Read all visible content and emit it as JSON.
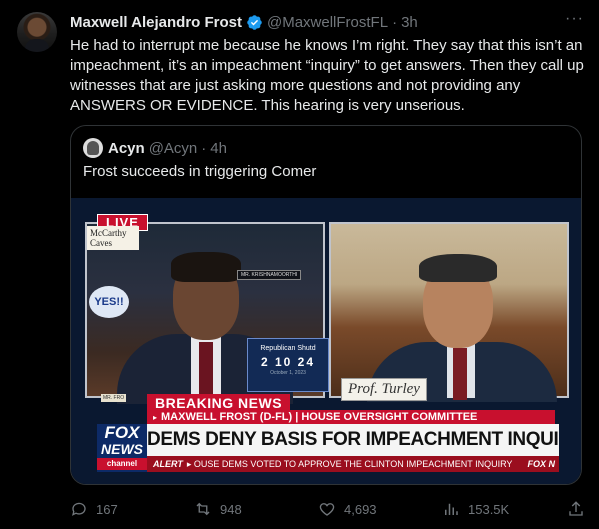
{
  "tweet": {
    "author_name": "Maxwell Alejandro Frost",
    "handle": "@MaxwellFrostFL",
    "separator": "·",
    "time": "3h",
    "more": "···",
    "text": "He had to interrupt me because he knows I’m right. They say that this isn’t an impeachment, it’s an impeachment “inquiry” to get answers. Then they call up witnesses that are just asking more questions and not providing any ANSWERS OR EVIDENCE. This hearing is very unserious."
  },
  "quote": {
    "author_name": "Acyn",
    "handle": "@Acyn",
    "separator": "·",
    "time": "4h",
    "text": "Frost succeeds in triggering Comer",
    "video": {
      "live_label": "LIVE",
      "sign_text": "McCarthy Caves",
      "yes_text": "YES!!",
      "left_namecard": "MR. KRISHNAMOORTHI",
      "countdown_title": "Republican Shutd",
      "countdown_nums": "2  10  24",
      "countdown_date": "October 1, 2023",
      "right_namecard": "Prof. Turley",
      "left_bottom_card": "MR. FRO",
      "breaking_label": "BREAKING NEWS",
      "subline": "MAXWELL FROST (D-FL) | HOUSE OVERSIGHT COMMITTEE",
      "headline": "DEMS DENY BASIS FOR IMPEACHMENT INQUIRY HEARING",
      "alert_label": "ALERT",
      "alert_text": "OUSE DEMS VOTED TO APPROVE THE CLINTON IMPEACHMENT INQUIRY",
      "alert_logo": "FOX N",
      "logo_line1": "FOX",
      "logo_line2": "NEWS",
      "logo_line3": "channel"
    }
  },
  "actions": {
    "replies": "167",
    "reposts": "948",
    "likes": "4,693",
    "views": "153.5K"
  },
  "colors": {
    "background": "#000000",
    "text": "#e7e9ea",
    "muted": "#71767b",
    "verified": "#1d9bf0",
    "fox_red": "#c8102e",
    "fox_blue": "#0d2a66"
  }
}
